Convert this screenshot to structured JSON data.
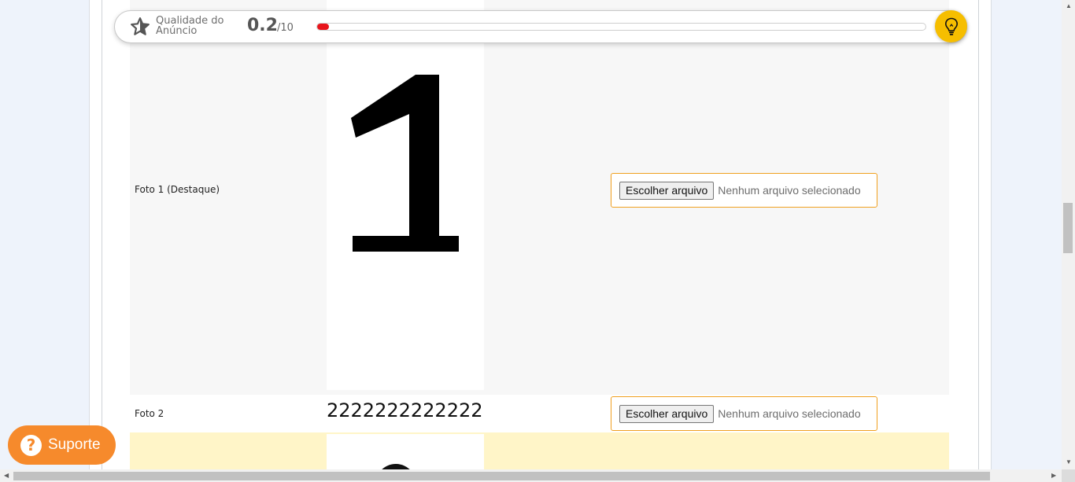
{
  "quality": {
    "label": "Qualidade do Anúncio",
    "score": "0.2",
    "max": "/10",
    "progress_fraction": 0.02,
    "fill_color": "#e8141b",
    "star_icon": "star-icon",
    "tips_icon": "lightbulb-icon",
    "tips_color": "#f6be00"
  },
  "photos": [
    {
      "label": "Foto 1 (Destaque)",
      "button_label": "Escolher arquivo",
      "status": "Nenhum arquivo selecionado"
    },
    {
      "label": "Foto 2",
      "preview_text": "2222222222222",
      "button_label": "Escolher arquivo",
      "status": "Nenhum arquivo selecionado"
    }
  ],
  "support": {
    "label": "Suporte",
    "icon": "question-icon",
    "icon_glyph": "?",
    "color": "#f68a2c"
  },
  "highlight_color": "#fff5c8",
  "accent_border": "#f0a020"
}
